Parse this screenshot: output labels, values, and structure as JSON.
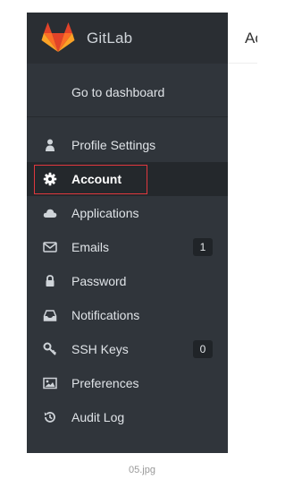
{
  "brand": {
    "name": "GitLab",
    "logo_icon": "gitlab-fox-icon"
  },
  "dashboard": {
    "label": "Go to dashboard"
  },
  "nav": {
    "items": [
      {
        "label": "Profile Settings",
        "icon": "user-icon"
      },
      {
        "label": "Account",
        "icon": "gear-icon",
        "active": true
      },
      {
        "label": "Applications",
        "icon": "cloud-icon"
      },
      {
        "label": "Emails",
        "icon": "envelope-icon",
        "badge": "1"
      },
      {
        "label": "Password",
        "icon": "lock-icon"
      },
      {
        "label": "Notifications",
        "icon": "inbox-icon"
      },
      {
        "label": "SSH Keys",
        "icon": "key-icon",
        "badge": "0"
      },
      {
        "label": "Preferences",
        "icon": "image-icon"
      },
      {
        "label": "Audit Log",
        "icon": "history-icon"
      }
    ]
  },
  "content": {
    "title": "Account"
  },
  "caption": "05.jpg",
  "colors": {
    "sidebar": "#30353b",
    "brand_bar": "#2a2e33",
    "active_item": "#24282c",
    "highlight_border": "#e0383e"
  }
}
